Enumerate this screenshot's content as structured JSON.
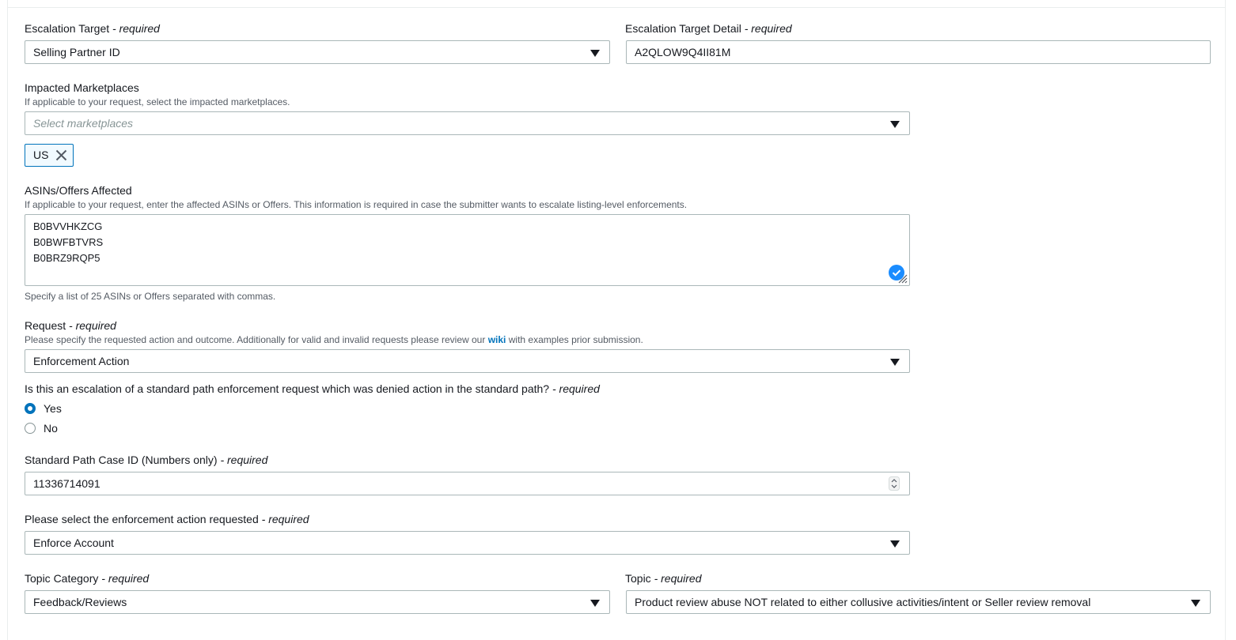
{
  "escalation_target": {
    "label": "Escalation Target",
    "required": "- required",
    "value": "Selling Partner ID"
  },
  "escalation_target_detail": {
    "label": "Escalation Target Detail",
    "required": "- required",
    "value": "A2QLOW9Q4II81M"
  },
  "impacted_marketplaces": {
    "label": "Impacted Marketplaces",
    "description": "If applicable to your request, select the impacted marketplaces.",
    "placeholder": "Select marketplaces",
    "tokens": [
      "US"
    ]
  },
  "asins": {
    "label": "ASINs/Offers Affected",
    "description": "If applicable to your request, enter the affected ASINs or Offers. This information is required in case the submitter wants to escalate listing-level enforcements.",
    "lines": [
      "B0BVVHKZCG",
      "B0BWFBTVRS",
      "B0BRZ9RQP5"
    ],
    "hint": "Specify a list of 25 ASINs or Offers separated with commas."
  },
  "request": {
    "label": "Request",
    "required": "- required",
    "description_before": "Please specify the requested action and outcome. Additionally for valid and invalid requests please review our",
    "link": "wiki",
    "description_after": "with examples prior submission.",
    "value": "Enforcement Action"
  },
  "escalation_question": {
    "label": "Is this an escalation of a standard path enforcement request which was denied action in the standard path?",
    "required": "- required",
    "options": [
      "Yes",
      "No"
    ],
    "selected": "Yes"
  },
  "case_id": {
    "label": "Standard Path Case ID (Numbers only)",
    "required": "- required",
    "value": "11336714091"
  },
  "enforcement_action": {
    "label": "Please select the enforcement action requested",
    "required": "- required",
    "value": "Enforce Account"
  },
  "topic_category": {
    "label": "Topic Category",
    "required": "- required",
    "value": "Feedback/Reviews"
  },
  "topic": {
    "label": "Topic",
    "required": "- required",
    "value": "Product review abuse NOT related to either collusive activities/intent or Seller review removal"
  },
  "colors": {
    "accent": "#0073bb",
    "border": "#aab7b8",
    "text": "#16191f",
    "muted": "#545b64"
  }
}
